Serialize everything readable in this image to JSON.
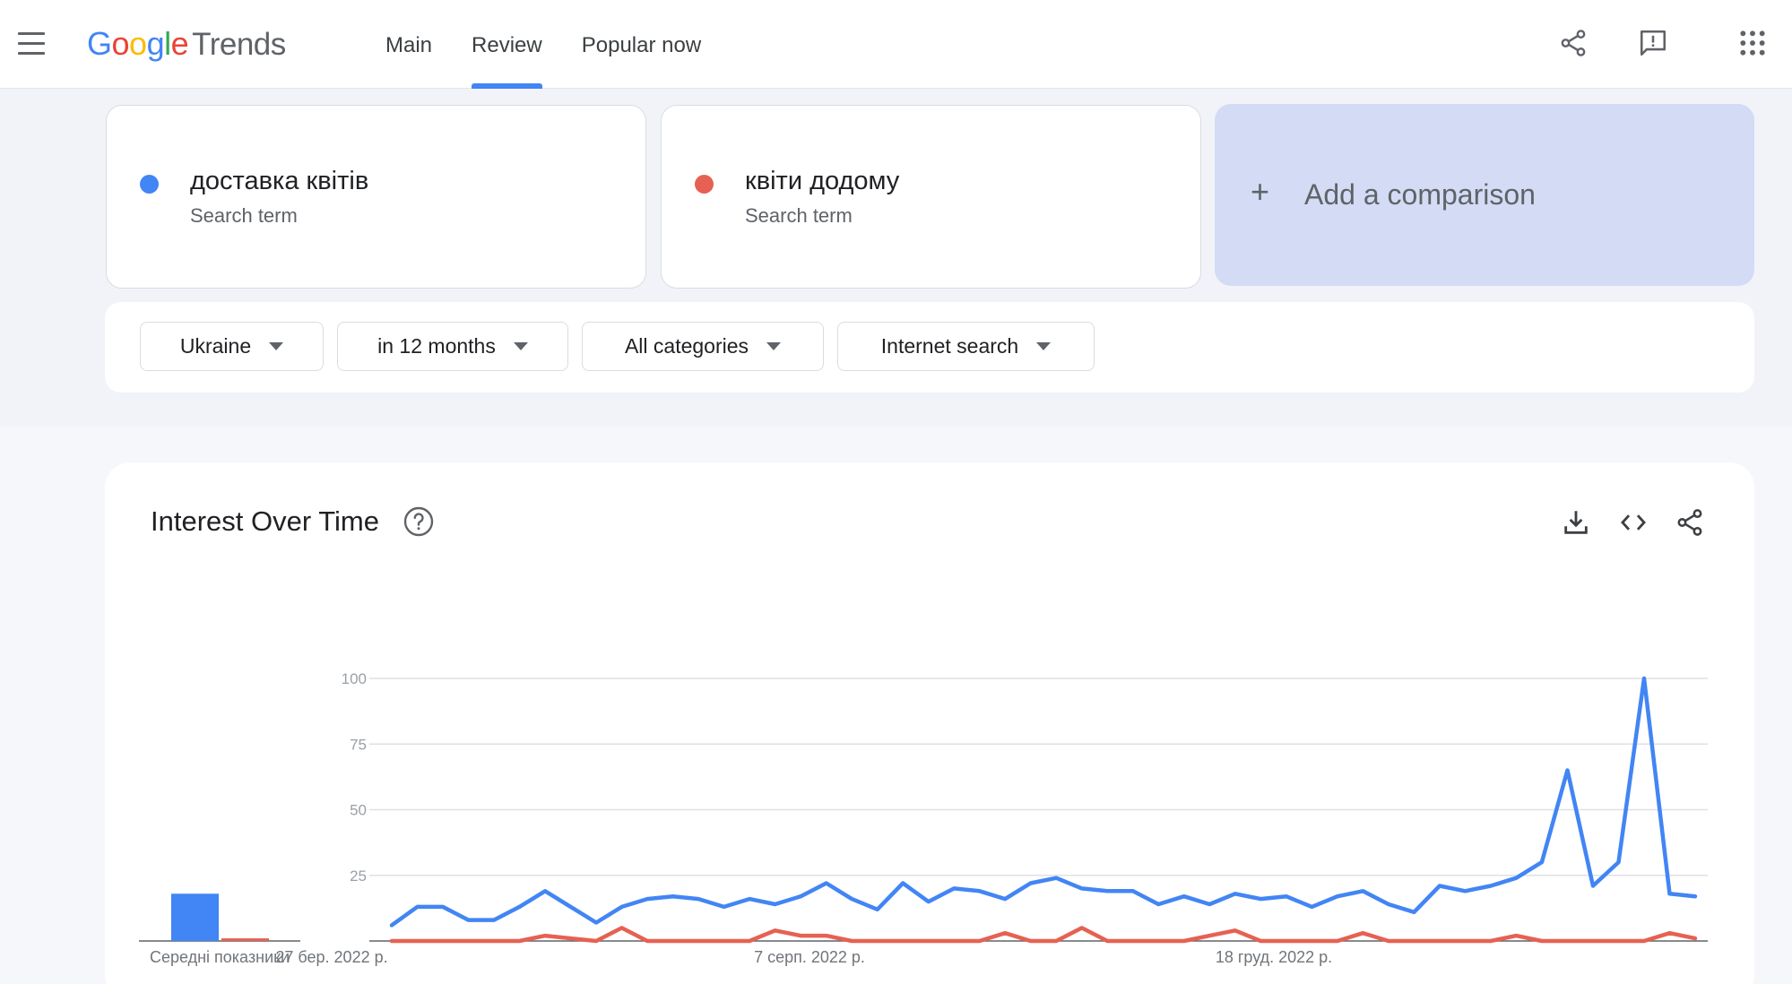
{
  "header": {
    "logo_google": [
      "G",
      "o",
      "o",
      "g",
      "l",
      "e"
    ],
    "logo_trends": "Trends",
    "tabs": [
      {
        "label": "Main",
        "active": false
      },
      {
        "label": "Review",
        "active": true
      },
      {
        "label": "Popular now",
        "active": false
      }
    ],
    "icons": [
      "menu-icon",
      "share-icon",
      "feedback-icon",
      "apps-icon"
    ]
  },
  "terms": [
    {
      "name": "доставка квітів",
      "type": "Search term",
      "color": "#4285f4"
    },
    {
      "name": "квіти додому",
      "type": "Search term",
      "color": "#e66153"
    }
  ],
  "add_comparison": {
    "plus": "+",
    "label": "Add a comparison"
  },
  "filters": [
    {
      "label": "Ukraine"
    },
    {
      "label": "in 12 months"
    },
    {
      "label": "All categories"
    },
    {
      "label": "Internet search"
    }
  ],
  "chart_card": {
    "title": "Interest Over Time",
    "icons": [
      "help-icon",
      "download-icon",
      "embed-code-icon",
      "share-icon"
    ]
  },
  "chart_data": {
    "type": "line",
    "title": "",
    "ylim": [
      0,
      100
    ],
    "yticks": [
      100,
      75,
      50,
      25
    ],
    "x_tick_labels": [
      "27 бер. 2022 р.",
      "7 серп. 2022 р.",
      "18 груд. 2022 р."
    ],
    "averages_label": "Середні показники",
    "averages": [
      {
        "name": "доставка квітів",
        "value": 18
      },
      {
        "name": "квіти додому",
        "value": 1
      }
    ],
    "series": [
      {
        "name": "доставка квітів",
        "color": "#4285f4",
        "values": [
          6,
          13,
          13,
          8,
          8,
          13,
          19,
          13,
          7,
          13,
          16,
          17,
          16,
          13,
          16,
          14,
          17,
          22,
          16,
          12,
          22,
          15,
          20,
          19,
          16,
          22,
          24,
          20,
          19,
          19,
          14,
          17,
          14,
          18,
          16,
          17,
          13,
          17,
          19,
          14,
          11,
          21,
          19,
          21,
          24,
          30,
          65,
          21,
          30,
          100,
          18,
          17
        ]
      },
      {
        "name": "квіти додому",
        "color": "#e66153",
        "values": [
          0,
          0,
          0,
          0,
          0,
          0,
          2,
          1,
          0,
          5,
          0,
          0,
          0,
          0,
          0,
          4,
          2,
          2,
          0,
          0,
          0,
          0,
          0,
          0,
          3,
          0,
          0,
          5,
          0,
          0,
          0,
          0,
          2,
          4,
          0,
          0,
          0,
          0,
          3,
          0,
          0,
          0,
          0,
          0,
          2,
          0,
          0,
          0,
          0,
          0,
          3,
          1
        ]
      }
    ]
  }
}
